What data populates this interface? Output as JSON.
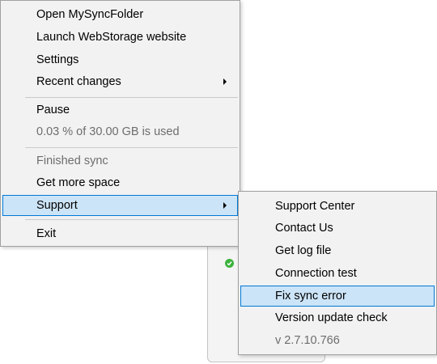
{
  "main_menu": {
    "open_folder": "Open MySyncFolder",
    "launch_website": "Launch WebStorage website",
    "settings": "Settings",
    "recent_changes": "Recent changes",
    "pause": "Pause",
    "usage": "0.03 % of 30.00 GB is used",
    "sync_status": "Finished sync",
    "get_more_space": "Get more space",
    "support": "Support",
    "exit": "Exit"
  },
  "support_menu": {
    "support_center": "Support Center",
    "contact_us": "Contact Us",
    "get_log_file": "Get log file",
    "connection_test": "Connection test",
    "fix_sync_error": "Fix sync error",
    "version_update_check": "Version update check",
    "version": "v 2.7.10.766"
  },
  "colors": {
    "menu_background": "#f2f2f2",
    "highlight_fill": "#cce4f7",
    "highlight_border": "#0078d7",
    "disabled_text": "#6d6d6d",
    "status_ok": "#3db33d"
  },
  "icons": [
    "submenu-arrow-icon",
    "sync-ok-check-icon"
  ]
}
